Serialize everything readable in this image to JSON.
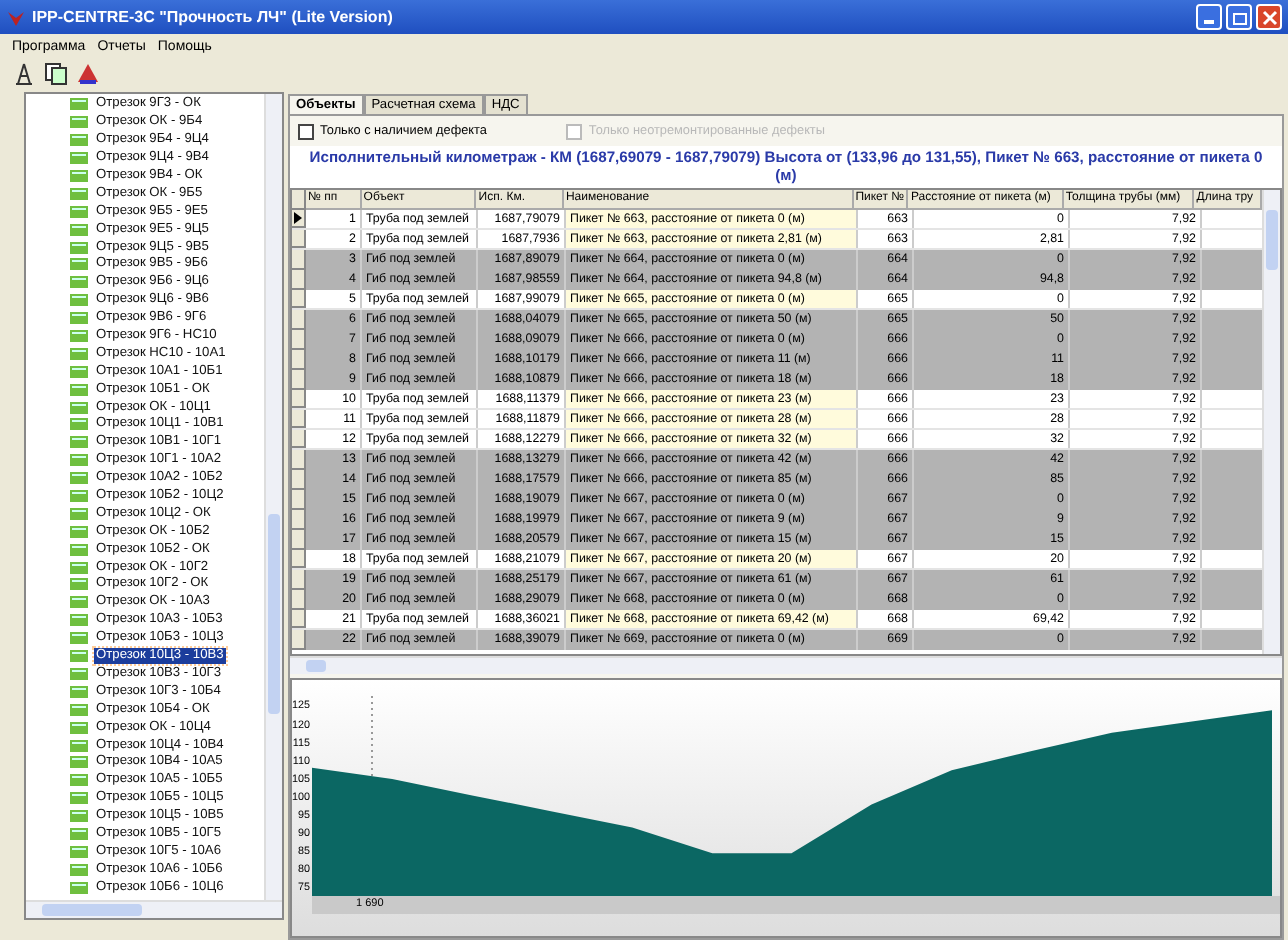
{
  "window": {
    "title": "IPP-CENTRE-3C \"Прочность ЛЧ\" (Lite Version)"
  },
  "menu": [
    "Программа",
    "Отчеты",
    "Помощь"
  ],
  "tree": [
    {
      "label": "Отрезок 9Г3 - ОК",
      "selected": false
    },
    {
      "label": "Отрезок ОК - 9Б4",
      "selected": false
    },
    {
      "label": "Отрезок 9Б4 - 9Ц4",
      "selected": false
    },
    {
      "label": "Отрезок 9Ц4 - 9В4",
      "selected": false
    },
    {
      "label": "Отрезок 9В4 - ОК",
      "selected": false
    },
    {
      "label": "Отрезок ОК - 9Б5",
      "selected": false
    },
    {
      "label": "Отрезок 9Б5 - 9Е5",
      "selected": false
    },
    {
      "label": "Отрезок 9Е5 - 9Ц5",
      "selected": false
    },
    {
      "label": "Отрезок 9Ц5 - 9В5",
      "selected": false
    },
    {
      "label": "Отрезок 9В5 - 9Б6",
      "selected": false
    },
    {
      "label": "Отрезок 9Б6 - 9Ц6",
      "selected": false
    },
    {
      "label": "Отрезок 9Ц6 - 9В6",
      "selected": false
    },
    {
      "label": "Отрезок 9В6 - 9Г6",
      "selected": false
    },
    {
      "label": "Отрезок 9Г6 - НС10",
      "selected": false
    },
    {
      "label": "Отрезок НС10 - 10А1",
      "selected": false
    },
    {
      "label": "Отрезок 10А1 - 10Б1",
      "selected": false
    },
    {
      "label": "Отрезок 10Б1 - ОК",
      "selected": false
    },
    {
      "label": "Отрезок ОК - 10Ц1",
      "selected": false
    },
    {
      "label": "Отрезок 10Ц1 - 10В1",
      "selected": false
    },
    {
      "label": "Отрезок 10В1 - 10Г1",
      "selected": false
    },
    {
      "label": "Отрезок 10Г1 - 10А2",
      "selected": false
    },
    {
      "label": "Отрезок 10А2 - 10Б2",
      "selected": false
    },
    {
      "label": "Отрезок 10Б2 - 10Ц2",
      "selected": false
    },
    {
      "label": "Отрезок 10Ц2 - ОК",
      "selected": false
    },
    {
      "label": "Отрезок ОК - 10Б2",
      "selected": false
    },
    {
      "label": "Отрезок 10Б2 - ОК",
      "selected": false
    },
    {
      "label": "Отрезок ОК - 10Г2",
      "selected": false
    },
    {
      "label": "Отрезок 10Г2 - ОК",
      "selected": false
    },
    {
      "label": "Отрезок ОК - 10А3",
      "selected": false
    },
    {
      "label": "Отрезок 10А3 - 10Б3",
      "selected": false
    },
    {
      "label": "Отрезок 10Б3 - 10Ц3",
      "selected": false
    },
    {
      "label": "Отрезок 10Ц3 - 10В3",
      "selected": true
    },
    {
      "label": "Отрезок 10В3 - 10Г3",
      "selected": false
    },
    {
      "label": "Отрезок 10Г3 - 10Б4",
      "selected": false
    },
    {
      "label": "Отрезок 10Б4 - ОК",
      "selected": false
    },
    {
      "label": "Отрезок ОК - 10Ц4",
      "selected": false
    },
    {
      "label": "Отрезок 10Ц4 - 10В4",
      "selected": false
    },
    {
      "label": "Отрезок 10В4 - 10А5",
      "selected": false
    },
    {
      "label": "Отрезок 10А5 - 10Б5",
      "selected": false
    },
    {
      "label": "Отрезок 10Б5 - 10Ц5",
      "selected": false
    },
    {
      "label": "Отрезок 10Ц5 - 10В5",
      "selected": false
    },
    {
      "label": "Отрезок 10В5 - 10Г5",
      "selected": false
    },
    {
      "label": "Отрезок 10Г5 - 10А6",
      "selected": false
    },
    {
      "label": "Отрезок 10А6 - 10Б6",
      "selected": false
    },
    {
      "label": "Отрезок 10Б6 - 10Ц6",
      "selected": false
    }
  ],
  "tabs": [
    {
      "label": "Объекты",
      "selected": true
    },
    {
      "label": "Расчетная схема",
      "selected": false
    },
    {
      "label": "НДС",
      "selected": false
    }
  ],
  "filters": [
    {
      "label": "Только с наличием дефекта",
      "checked": false,
      "disabled": false
    },
    {
      "label": "Только неотремонтированные дефекты",
      "checked": false,
      "disabled": true
    }
  ],
  "heading": "Исполнительный километраж - КМ (1687,69079 - 1687,79079) Высота от (133,96 до 131,55), Пикет № 663, расстояние от пикета 0 (м)",
  "table": {
    "columns": [
      "№ пп",
      "Объект",
      "Исп. Км.",
      "Наименование",
      "Пикет №",
      "Расстояние от пикета (м)",
      "Толщина трубы (мм)",
      "Длина тру"
    ],
    "rows": [
      {
        "n": "1",
        "object": "Труба под землей",
        "km": "1687,79079",
        "name": "Пикет № 663, расстояние от пикета 0 (м)",
        "picket": "663",
        "dist": "0",
        "thick": "7,92",
        "kind": "pipe",
        "selected": true
      },
      {
        "n": "2",
        "object": "Труба под землей",
        "km": "1687,7936",
        "name": "Пикет № 663, расстояние от пикета 2,81 (м)",
        "picket": "663",
        "dist": "2,81",
        "thick": "7,92",
        "kind": "pipe",
        "selected": false
      },
      {
        "n": "3",
        "object": "Гиб под землей",
        "km": "1687,89079",
        "name": "Пикет № 664, расстояние от пикета 0 (м)",
        "picket": "664",
        "dist": "0",
        "thick": "7,92",
        "kind": "bend",
        "selected": false
      },
      {
        "n": "4",
        "object": "Гиб под землей",
        "km": "1687,98559",
        "name": "Пикет № 664, расстояние от пикета 94,8 (м)",
        "picket": "664",
        "dist": "94,8",
        "thick": "7,92",
        "kind": "bend",
        "selected": false
      },
      {
        "n": "5",
        "object": "Труба под землей",
        "km": "1687,99079",
        "name": "Пикет № 665, расстояние от пикета 0 (м)",
        "picket": "665",
        "dist": "0",
        "thick": "7,92",
        "kind": "pipe",
        "selected": false
      },
      {
        "n": "6",
        "object": "Гиб под землей",
        "km": "1688,04079",
        "name": "Пикет № 665, расстояние от пикета 50 (м)",
        "picket": "665",
        "dist": "50",
        "thick": "7,92",
        "kind": "bend",
        "selected": false
      },
      {
        "n": "7",
        "object": "Гиб под землей",
        "km": "1688,09079",
        "name": "Пикет № 666, расстояние от пикета 0 (м)",
        "picket": "666",
        "dist": "0",
        "thick": "7,92",
        "kind": "bend",
        "selected": false
      },
      {
        "n": "8",
        "object": "Гиб под землей",
        "km": "1688,10179",
        "name": "Пикет № 666, расстояние от пикета 11 (м)",
        "picket": "666",
        "dist": "11",
        "thick": "7,92",
        "kind": "bend",
        "selected": false
      },
      {
        "n": "9",
        "object": "Гиб под землей",
        "km": "1688,10879",
        "name": "Пикет № 666, расстояние от пикета 18 (м)",
        "picket": "666",
        "dist": "18",
        "thick": "7,92",
        "kind": "bend",
        "selected": false
      },
      {
        "n": "10",
        "object": "Труба под землей",
        "km": "1688,11379",
        "name": "Пикет № 666, расстояние от пикета 23 (м)",
        "picket": "666",
        "dist": "23",
        "thick": "7,92",
        "kind": "pipe",
        "selected": false
      },
      {
        "n": "11",
        "object": "Труба под землей",
        "km": "1688,11879",
        "name": "Пикет № 666, расстояние от пикета 28 (м)",
        "picket": "666",
        "dist": "28",
        "thick": "7,92",
        "kind": "pipe",
        "selected": false
      },
      {
        "n": "12",
        "object": "Труба под землей",
        "km": "1688,12279",
        "name": "Пикет № 666, расстояние от пикета 32 (м)",
        "picket": "666",
        "dist": "32",
        "thick": "7,92",
        "kind": "pipe",
        "selected": false
      },
      {
        "n": "13",
        "object": "Гиб под землей",
        "km": "1688,13279",
        "name": "Пикет № 666, расстояние от пикета 42 (м)",
        "picket": "666",
        "dist": "42",
        "thick": "7,92",
        "kind": "bend",
        "selected": false
      },
      {
        "n": "14",
        "object": "Гиб под землей",
        "km": "1688,17579",
        "name": "Пикет № 666, расстояние от пикета 85 (м)",
        "picket": "666",
        "dist": "85",
        "thick": "7,92",
        "kind": "bend",
        "selected": false
      },
      {
        "n": "15",
        "object": "Гиб под землей",
        "km": "1688,19079",
        "name": "Пикет № 667, расстояние от пикета 0 (м)",
        "picket": "667",
        "dist": "0",
        "thick": "7,92",
        "kind": "bend",
        "selected": false
      },
      {
        "n": "16",
        "object": "Гиб под землей",
        "km": "1688,19979",
        "name": "Пикет № 667, расстояние от пикета 9 (м)",
        "picket": "667",
        "dist": "9",
        "thick": "7,92",
        "kind": "bend",
        "selected": false
      },
      {
        "n": "17",
        "object": "Гиб под землей",
        "km": "1688,20579",
        "name": "Пикет № 667, расстояние от пикета 15 (м)",
        "picket": "667",
        "dist": "15",
        "thick": "7,92",
        "kind": "bend",
        "selected": false
      },
      {
        "n": "18",
        "object": "Труба под землей",
        "km": "1688,21079",
        "name": "Пикет № 667, расстояние от пикета 20 (м)",
        "picket": "667",
        "dist": "20",
        "thick": "7,92",
        "kind": "pipe",
        "selected": false
      },
      {
        "n": "19",
        "object": "Гиб под землей",
        "km": "1688,25179",
        "name": "Пикет № 667, расстояние от пикета 61 (м)",
        "picket": "667",
        "dist": "61",
        "thick": "7,92",
        "kind": "bend",
        "selected": false
      },
      {
        "n": "20",
        "object": "Гиб под землей",
        "km": "1688,29079",
        "name": "Пикет № 668, расстояние от пикета 0 (м)",
        "picket": "668",
        "dist": "0",
        "thick": "7,92",
        "kind": "bend",
        "selected": false
      },
      {
        "n": "21",
        "object": "Труба под землей",
        "km": "1688,36021",
        "name": "Пикет № 668, расстояние от пикета 69,42 (м)",
        "picket": "668",
        "dist": "69,42",
        "thick": "7,92",
        "kind": "pipe",
        "selected": false
      },
      {
        "n": "22",
        "object": "Гиб под землей",
        "km": "1688,39079",
        "name": "Пикет № 669, расстояние от пикета 0 (м)",
        "picket": "669",
        "dist": "0",
        "thick": "7,92",
        "kind": "bend",
        "selected": false
      }
    ]
  },
  "profile": {
    "x_label": "1 690",
    "chart_data": {
      "type": "area",
      "categories": [
        null,
        null,
        null,
        null,
        null,
        null,
        null,
        null,
        null,
        null,
        null,
        null,
        null
      ],
      "series": [
        {
          "color": "#0b6763",
          "values": [
            108,
            104.9,
            100.4,
            96,
            91.6,
            84.5,
            84.5,
            97.9,
            107.3,
            112.6,
            117.6,
            120.7,
            123.8
          ]
        }
      ],
      "ylim": [
        73,
        128
      ],
      "yticks": [
        {
          "value": 75,
          "label": "75"
        },
        {
          "value": 80,
          "label": "80"
        },
        {
          "value": 85,
          "label": "85"
        },
        {
          "value": 90,
          "label": "90"
        },
        {
          "value": 95,
          "label": "95"
        },
        {
          "value": 100,
          "label": "100"
        },
        {
          "value": 105,
          "label": "105"
        },
        {
          "value": 110,
          "label": "110"
        },
        {
          "value": 115,
          "label": "115"
        },
        {
          "value": 120,
          "label": "120"
        },
        {
          "value": 125,
          "label": "125"
        }
      ]
    }
  }
}
